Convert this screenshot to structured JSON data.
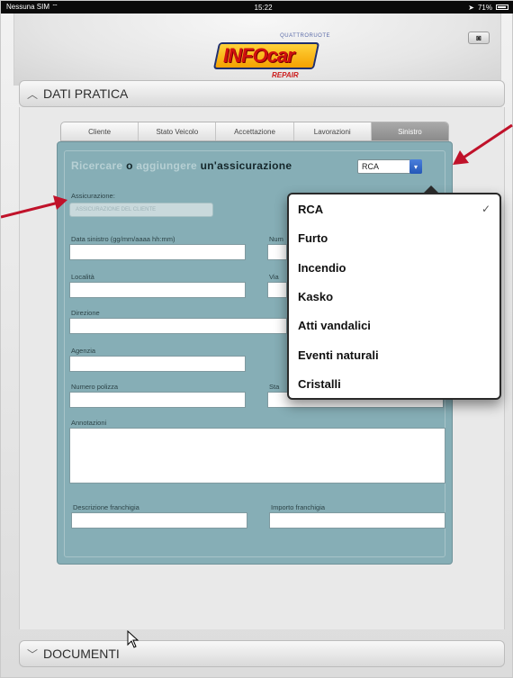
{
  "status_bar": {
    "carrier": "Nessuna SIM ⌔",
    "time": "15:22",
    "battery": "71%"
  },
  "header": {
    "logo_tag": "QUATTRORUOTE",
    "logo_word": "INFOcar",
    "logo_sub": "REPAIR",
    "camera_icon": "camera-icon"
  },
  "sections": {
    "top_label": "DATI PRATICA",
    "bottom_label": "DOCUMENTI"
  },
  "tabs": [
    {
      "label": "Cliente",
      "active": false
    },
    {
      "label": "Stato Veicolo",
      "active": false
    },
    {
      "label": "Accettazione",
      "active": false
    },
    {
      "label": "Lavorazioni",
      "active": false
    },
    {
      "label": "Sinistro",
      "active": true
    }
  ],
  "form": {
    "title_search": "Ricercare",
    "title_or": "o",
    "title_add": "aggiungere",
    "title_rest": "un'assicurazione",
    "type_select": {
      "value": "RCA"
    },
    "assicurazione": {
      "label": "Assicurazione:",
      "value": "ASSICURAZIONE DEL CLIENTE"
    },
    "data_sinistro": {
      "label": "Data sinistro (gg/mm/aaaa hh:mm)",
      "value": ""
    },
    "numero_label_partial": "Num",
    "localita": {
      "label": "Località",
      "value": ""
    },
    "via_label_partial": "Via",
    "direzione": {
      "label": "Direzione",
      "value": ""
    },
    "agenzia": {
      "label": "Agenzia",
      "value": ""
    },
    "numero_polizza": {
      "label": "Numero polizza",
      "value": ""
    },
    "stato_label_partial": "Sta",
    "annotazioni": {
      "label": "Annotazioni",
      "value": ""
    },
    "descrizione_franchigia": {
      "label": "Descrizione franchigia",
      "value": ""
    },
    "importo_franchigia": {
      "label": "Importo franchigia",
      "value": ""
    }
  },
  "popover": {
    "selected": "RCA",
    "items": [
      "RCA",
      "Furto",
      "Incendio",
      "Kasko",
      "Atti vandalici",
      "Eventi naturali",
      "Cristalli"
    ]
  },
  "colors": {
    "panel": "#86aeb6",
    "accent_arrow": "#c0122a",
    "select_button": "#2457b7"
  }
}
